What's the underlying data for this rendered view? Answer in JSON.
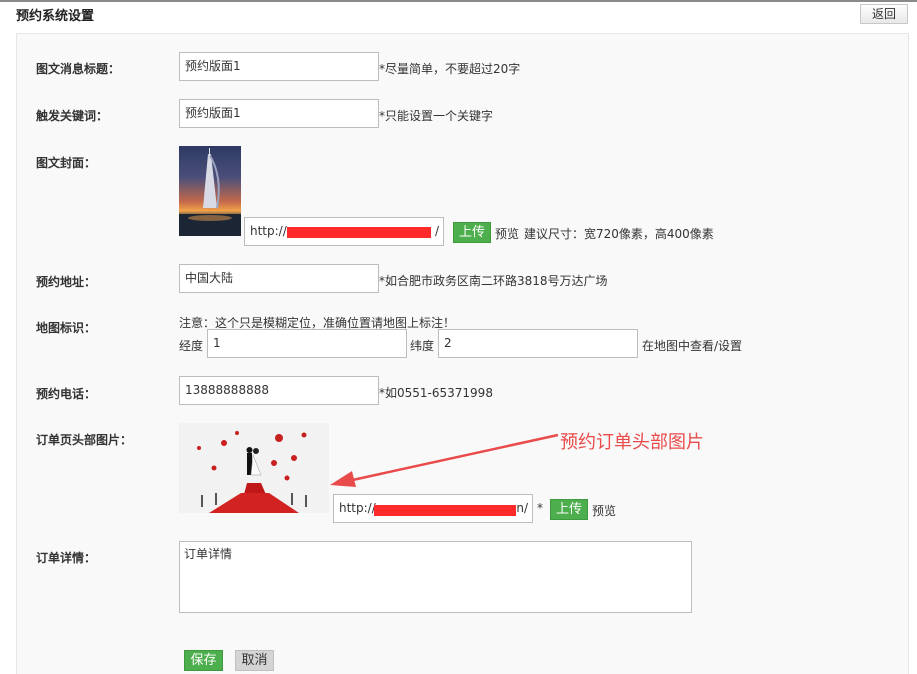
{
  "page": {
    "title": "预约系统设置",
    "back_label": "返回"
  },
  "form": {
    "title_label": "图文消息标题：",
    "title_value": "预约版面1",
    "title_hint": "*尽量简单，不要超过20字",
    "keyword_label": "触发关键词：",
    "keyword_value": "预约版面1",
    "keyword_hint": "*只能设置一个关键字",
    "cover_label": "图文封面：",
    "cover_url": "http://",
    "cover_url_suffix": "/",
    "upload_label": "上传",
    "preview_label": "预览",
    "cover_hint": "建议尺寸：宽720像素，高400像素",
    "address_label": "预约地址：",
    "address_value": "中国大陆",
    "address_hint": "*如合肥市政务区南二环路3818号万达广场",
    "map_label": "地图标识：",
    "map_notice": "注意：这个只是模糊定位，准确位置请地图上标注！",
    "longitude_label": "经度",
    "longitude_value": "1",
    "latitude_label": "纬度",
    "latitude_value": "2",
    "map_link": "在地图中查看/设置",
    "phone_label": "预约电话：",
    "phone_value": "13888888888",
    "phone_hint": "*如0551-65371998",
    "header_img_label": "订单页头部图片：",
    "header_img_url": "http://",
    "header_img_url_suffix": "n/",
    "header_img_star": "*",
    "detail_label": "订单详情：",
    "detail_value": "订单详情",
    "save_label": "保存",
    "cancel_label": "取消"
  },
  "annotation": {
    "text": "预约订单头部图片",
    "color": "#e94b4b"
  },
  "colors": {
    "accent_green": "#4cae4c",
    "redaction": "#ff2a2a"
  }
}
